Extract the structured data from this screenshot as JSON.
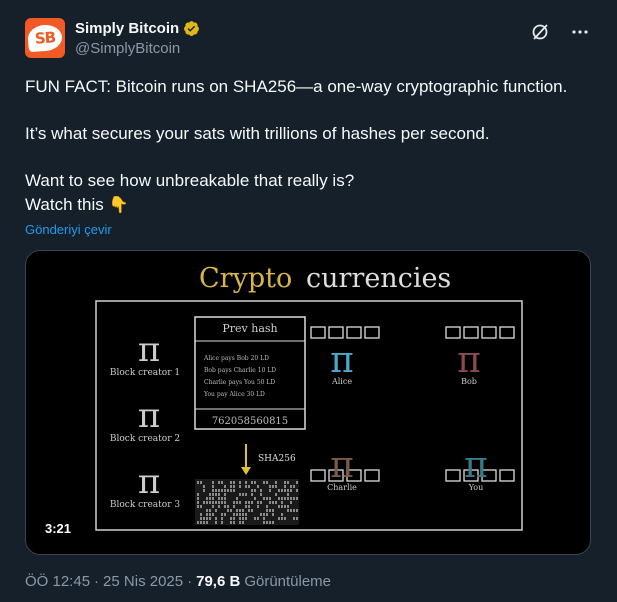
{
  "author": {
    "avatar_text": "SB",
    "display_name": "Simply Bitcoin",
    "handle": "@SimplyBitcoin",
    "verified": true
  },
  "icons": {
    "grok": "grok-icon",
    "more": "more-icon",
    "verified": "verified-badge-icon"
  },
  "tweet": {
    "line1": "FUN FACT: Bitcoin runs on SHA256—a one-way cryptographic function.",
    "line2": "It’s what secures your sats with trillions of hashes per second.",
    "line3": "Want to see how unbreakable that really is?",
    "line4": "Watch this",
    "line4_emoji": "👇",
    "translate": "Gönderiyi çevir"
  },
  "video": {
    "duration": "3:21",
    "title_part1": "Crypto",
    "title_part2": "currencies",
    "prev_hash": "Prev hash",
    "ledger": [
      "Alice pays Bob 20 LD",
      "Bob pays Charlie 10 LD",
      "Charlie pays You 50 LD",
      "You pay Alice 30 LD"
    ],
    "hash_number": "762058560815",
    "sha_label": "SHA256",
    "block_creators": [
      "Block creator 1",
      "Block creator 2",
      "Block creator 3"
    ],
    "people": [
      "Alice",
      "Bob",
      "Charlie",
      "You"
    ]
  },
  "meta": {
    "time": "ÖÖ 12:45",
    "separator1": "·",
    "date": "25 Nis 2025",
    "separator2": "·",
    "views_count": "79,6 B",
    "views_label": "Görüntüleme"
  },
  "colors": {
    "background": "#15202b",
    "link": "#1d9bf0",
    "secondary_text": "#8b98a5",
    "verified_gold": "#e2b719",
    "avatar_orange": "#f15a24",
    "title_gold": "#d8b64a"
  }
}
